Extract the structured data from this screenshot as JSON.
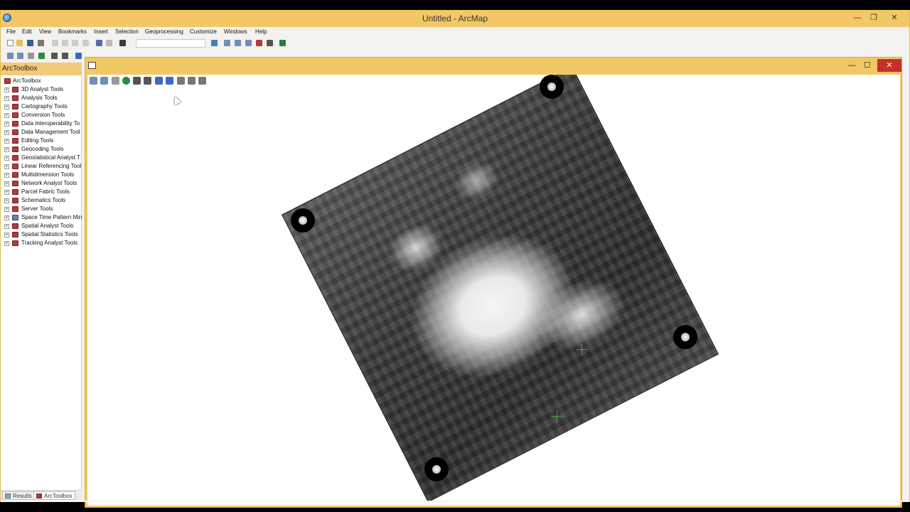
{
  "window": {
    "title": "Untitled - ArcMap",
    "minimize": "—",
    "maximize": "❐",
    "close": "✕"
  },
  "menu": [
    "File",
    "Edit",
    "View",
    "Bookmarks",
    "Insert",
    "Selection",
    "Geoprocessing",
    "Customize",
    "Windows",
    "Help"
  ],
  "toc": {
    "title": "ArcToolbox",
    "root": "ArcToolbox",
    "items": [
      "3D Analyst Tools",
      "Analysis Tools",
      "Cartography Tools",
      "Conversion Tools",
      "Data Interoperability To",
      "Data Management Tool",
      "Editing Tools",
      "Geocoding Tools",
      "Geostatistical Analyst T",
      "Linear Referencing Tool",
      "Multidimension Tools",
      "Network Analyst Tools",
      "Parcel Fabric Tools",
      "Schematics Tools",
      "Server Tools",
      "Space Time Pattern Min",
      "Spatial Analyst Tools",
      "Spatial Statistics Tools",
      "Tracking Analyst Tools"
    ],
    "tabs": [
      "Results",
      "ArcToolbox"
    ]
  },
  "georef_window": {
    "minimize": "—",
    "maximize": "☐",
    "close": "✕"
  },
  "colors": {
    "title_bar": "#f2c866",
    "panel_header": "#f4c978",
    "close_red": "#c7302a",
    "gcp_green": "#3ca43c",
    "toolbox_red": "#b23a3a"
  }
}
